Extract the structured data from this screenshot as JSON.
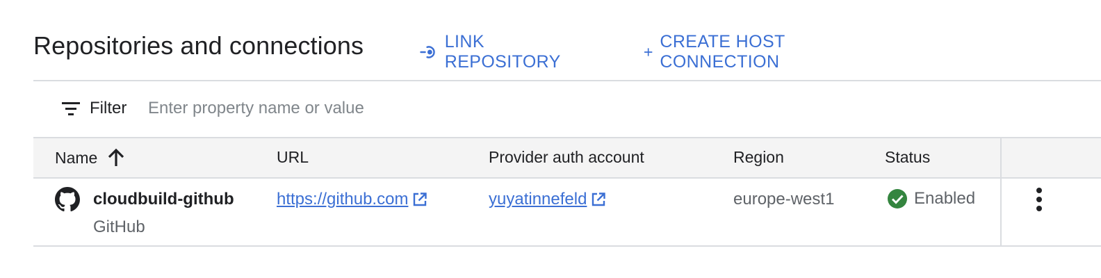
{
  "header": {
    "title": "Repositories and connections",
    "link_repository_label": "LINK REPOSITORY",
    "create_host_connection_label": "CREATE HOST CONNECTION"
  },
  "filter": {
    "label": "Filter",
    "placeholder": "Enter property name or value"
  },
  "table": {
    "columns": {
      "name": "Name",
      "url": "URL",
      "provider_auth_account": "Provider auth account",
      "region": "Region",
      "status": "Status"
    },
    "sort": {
      "column": "name",
      "direction": "ascending"
    },
    "rows": [
      {
        "name": "cloudbuild-github",
        "provider": "GitHub",
        "url": "https://github.com",
        "auth_account": "yuyatinnefeld",
        "region": "europe-west1",
        "status": "Enabled"
      }
    ]
  },
  "colors": {
    "accent": "#3b6fd4",
    "status_enabled": "#34853f",
    "divider": "#dadce0",
    "header_bg": "#f4f4f4"
  },
  "icons": {
    "link_repository": "link-connect-icon",
    "create_host_connection": "plus-icon",
    "filter": "filter-icon",
    "sort": "arrow-up-icon",
    "provider": "github-icon",
    "external_link": "external-link-icon",
    "status": "check-circle-icon",
    "row_menu": "more-vert-icon"
  }
}
